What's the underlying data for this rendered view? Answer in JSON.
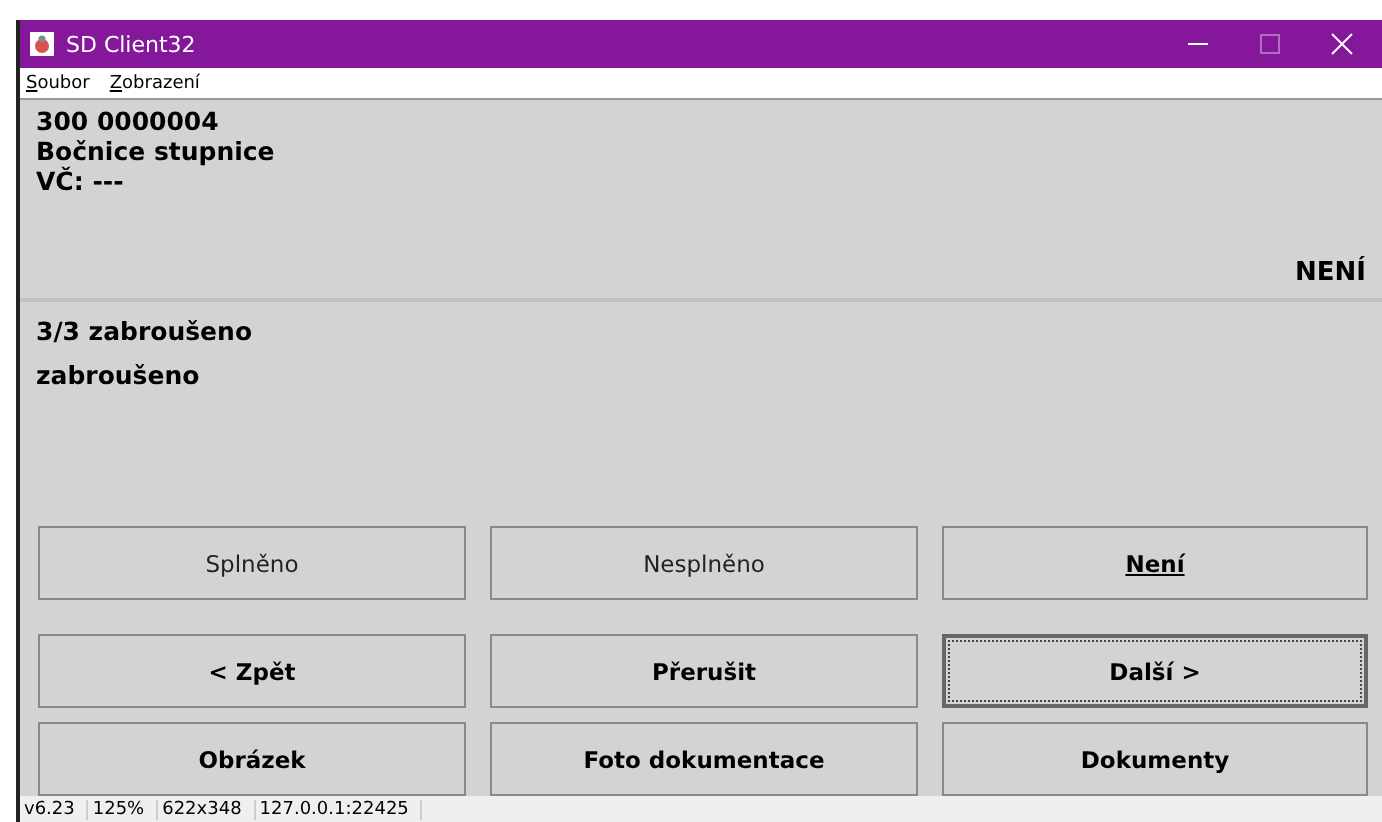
{
  "window": {
    "title": "SD Client32"
  },
  "menu": [
    {
      "label": "Soubor"
    },
    {
      "label": "Zobrazení"
    }
  ],
  "header": {
    "lines": [
      "300 0000004",
      "Bočnice stupnice",
      "VČ: ---"
    ],
    "status": "NENÍ"
  },
  "question": {
    "title": "3/3 zabroušeno",
    "text": "zabroušeno"
  },
  "answers": [
    {
      "label": "Splněno",
      "selected": false
    },
    {
      "label": "Nesplněno",
      "selected": false
    },
    {
      "label": "Není",
      "selected": true
    }
  ],
  "buttons": [
    {
      "label": "< Zpět",
      "focused": false
    },
    {
      "label": "Přerušit",
      "focused": false
    },
    {
      "label": "Další >",
      "focused": true
    },
    {
      "label": "Obrázek",
      "focused": false
    },
    {
      "label": "Foto dokumentace",
      "focused": false
    },
    {
      "label": "Dokumenty",
      "focused": false
    }
  ],
  "status_bar": [
    "v6.23",
    "125%",
    "622x348",
    "127.0.0.1:22425"
  ]
}
